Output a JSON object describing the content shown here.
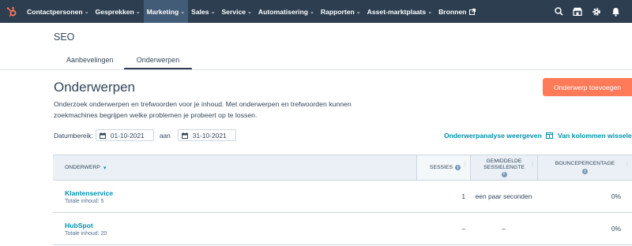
{
  "colors": {
    "nav_bg": "#2d3e50",
    "accent": "#ff7a59",
    "link": "#0091ae",
    "text": "#33475b"
  },
  "topnav": {
    "logo_icon": "hubspot-sprocket-icon",
    "items": [
      {
        "label": "Contactpersonen",
        "has_menu": true
      },
      {
        "label": "Gesprekken",
        "has_menu": true
      },
      {
        "label": "Marketing",
        "has_menu": true,
        "active": true
      },
      {
        "label": "Sales",
        "has_menu": true
      },
      {
        "label": "Service",
        "has_menu": true
      },
      {
        "label": "Automatisering",
        "has_menu": true
      },
      {
        "label": "Rapporten",
        "has_menu": true
      },
      {
        "label": "Asset-marktplaats",
        "has_menu": true
      },
      {
        "label": "Bronnen",
        "external": true
      }
    ],
    "right_icons": [
      "search-icon",
      "marketplace-icon",
      "settings-icon",
      "notifications-icon"
    ]
  },
  "page": {
    "title": "SEO",
    "tabs": [
      {
        "label": "Aanbevelingen",
        "active": false
      },
      {
        "label": "Onderwerpen",
        "active": true
      }
    ]
  },
  "section": {
    "title": "Onderwerpen",
    "primary_button": "Onderwerp toevoegen",
    "description": "Onderzoek onderwerpen en trefwoorden voor je inhoud. Met onderwerpen en trefwoorden kunnen zoekmachines begrijpen welke problemen je probeert op te lossen."
  },
  "date_range": {
    "label": "Datumbereik:",
    "from": "01-10-2021",
    "separator": "aan",
    "to": "31-10-2021"
  },
  "actions": {
    "analysis_link": "Onderwerpanalyse weergeven",
    "columns_link": "Van kolommen wisselen"
  },
  "table": {
    "columns": {
      "topic": "ONDERWERP",
      "sessions": "SESSIES",
      "duration_line1": "GEMIDDELDE",
      "duration_line2": "SESSIELENGTE",
      "bounce": "BOUNCEPERCENTAGE"
    },
    "rows": [
      {
        "name": "Klantenservice",
        "sub": "Totale inhoud: 5",
        "sessions": "1",
        "duration": "een paar seconden",
        "bounce": "0%"
      },
      {
        "name": "HubSpot",
        "sub": "Totale inhoud: 20",
        "sessions": "–",
        "duration": "–",
        "bounce": "0%"
      }
    ]
  }
}
